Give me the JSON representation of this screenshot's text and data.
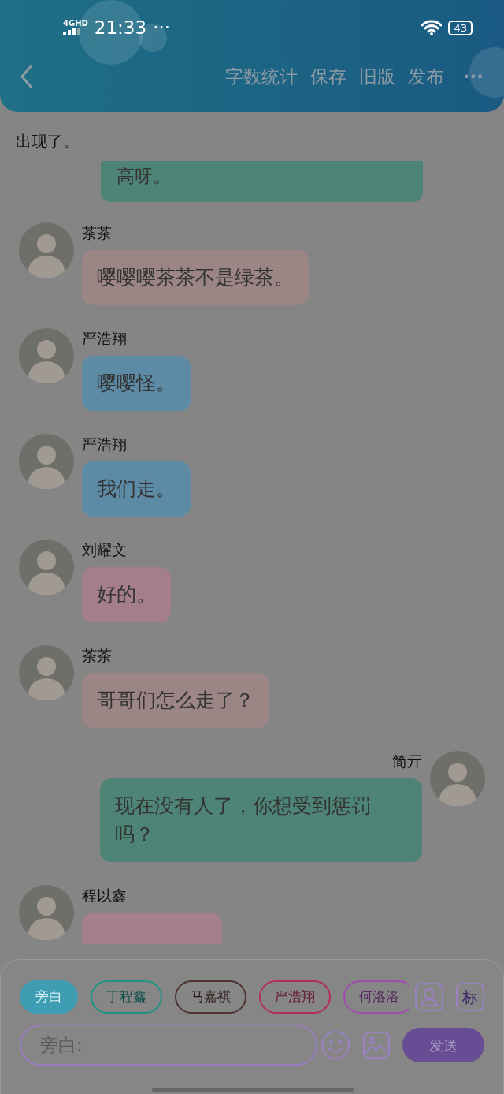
{
  "status_bar": {
    "network": "4GHD",
    "time": "21:33",
    "dots": "···",
    "battery": "43"
  },
  "header": {
    "actions": [
      "字数统计",
      "保存",
      "旧版",
      "发布"
    ],
    "more": "···"
  },
  "narration": "出现了。",
  "messages": [
    {
      "kind": "partial",
      "text": "高呀。",
      "color": "#4e8476"
    },
    {
      "kind": "received",
      "name": "茶茶",
      "text": "嘤嘤嘤茶茶不是绿茶。",
      "color": "#9b8585"
    },
    {
      "kind": "received",
      "name": "严浩翔",
      "text": "嘤嘤怪。",
      "color": "#5d8ba6"
    },
    {
      "kind": "received",
      "name": "严浩翔",
      "text": "我们走。",
      "color": "#5d8ba6"
    },
    {
      "kind": "received",
      "name": "刘耀文",
      "text": "好的。",
      "color": "#a47f8a"
    },
    {
      "kind": "received",
      "name": "茶茶",
      "text": "哥哥们怎么走了？",
      "color": "#9b8585"
    },
    {
      "kind": "sent",
      "name": "简亓",
      "text": "现在没有人了，你想受到惩罚吗？",
      "color": "#4e8476"
    },
    {
      "kind": "covered",
      "name": "程以鑫",
      "color": "#a67f8c"
    }
  ],
  "roles": [
    {
      "label": "旁白",
      "selected": true,
      "color": "#3e9db3"
    },
    {
      "label": "丁程鑫",
      "selected": false,
      "color": "#1f9384"
    },
    {
      "label": "马嘉祺",
      "selected": false,
      "color": "#4e3330"
    },
    {
      "label": "严浩翔",
      "selected": false,
      "color": "#b52c56"
    },
    {
      "label": "何洛洛",
      "selected": false,
      "color": "#a04cb0"
    }
  ],
  "mark_button": "标",
  "input": {
    "placeholder": "旁白:"
  },
  "send_button": "发送"
}
